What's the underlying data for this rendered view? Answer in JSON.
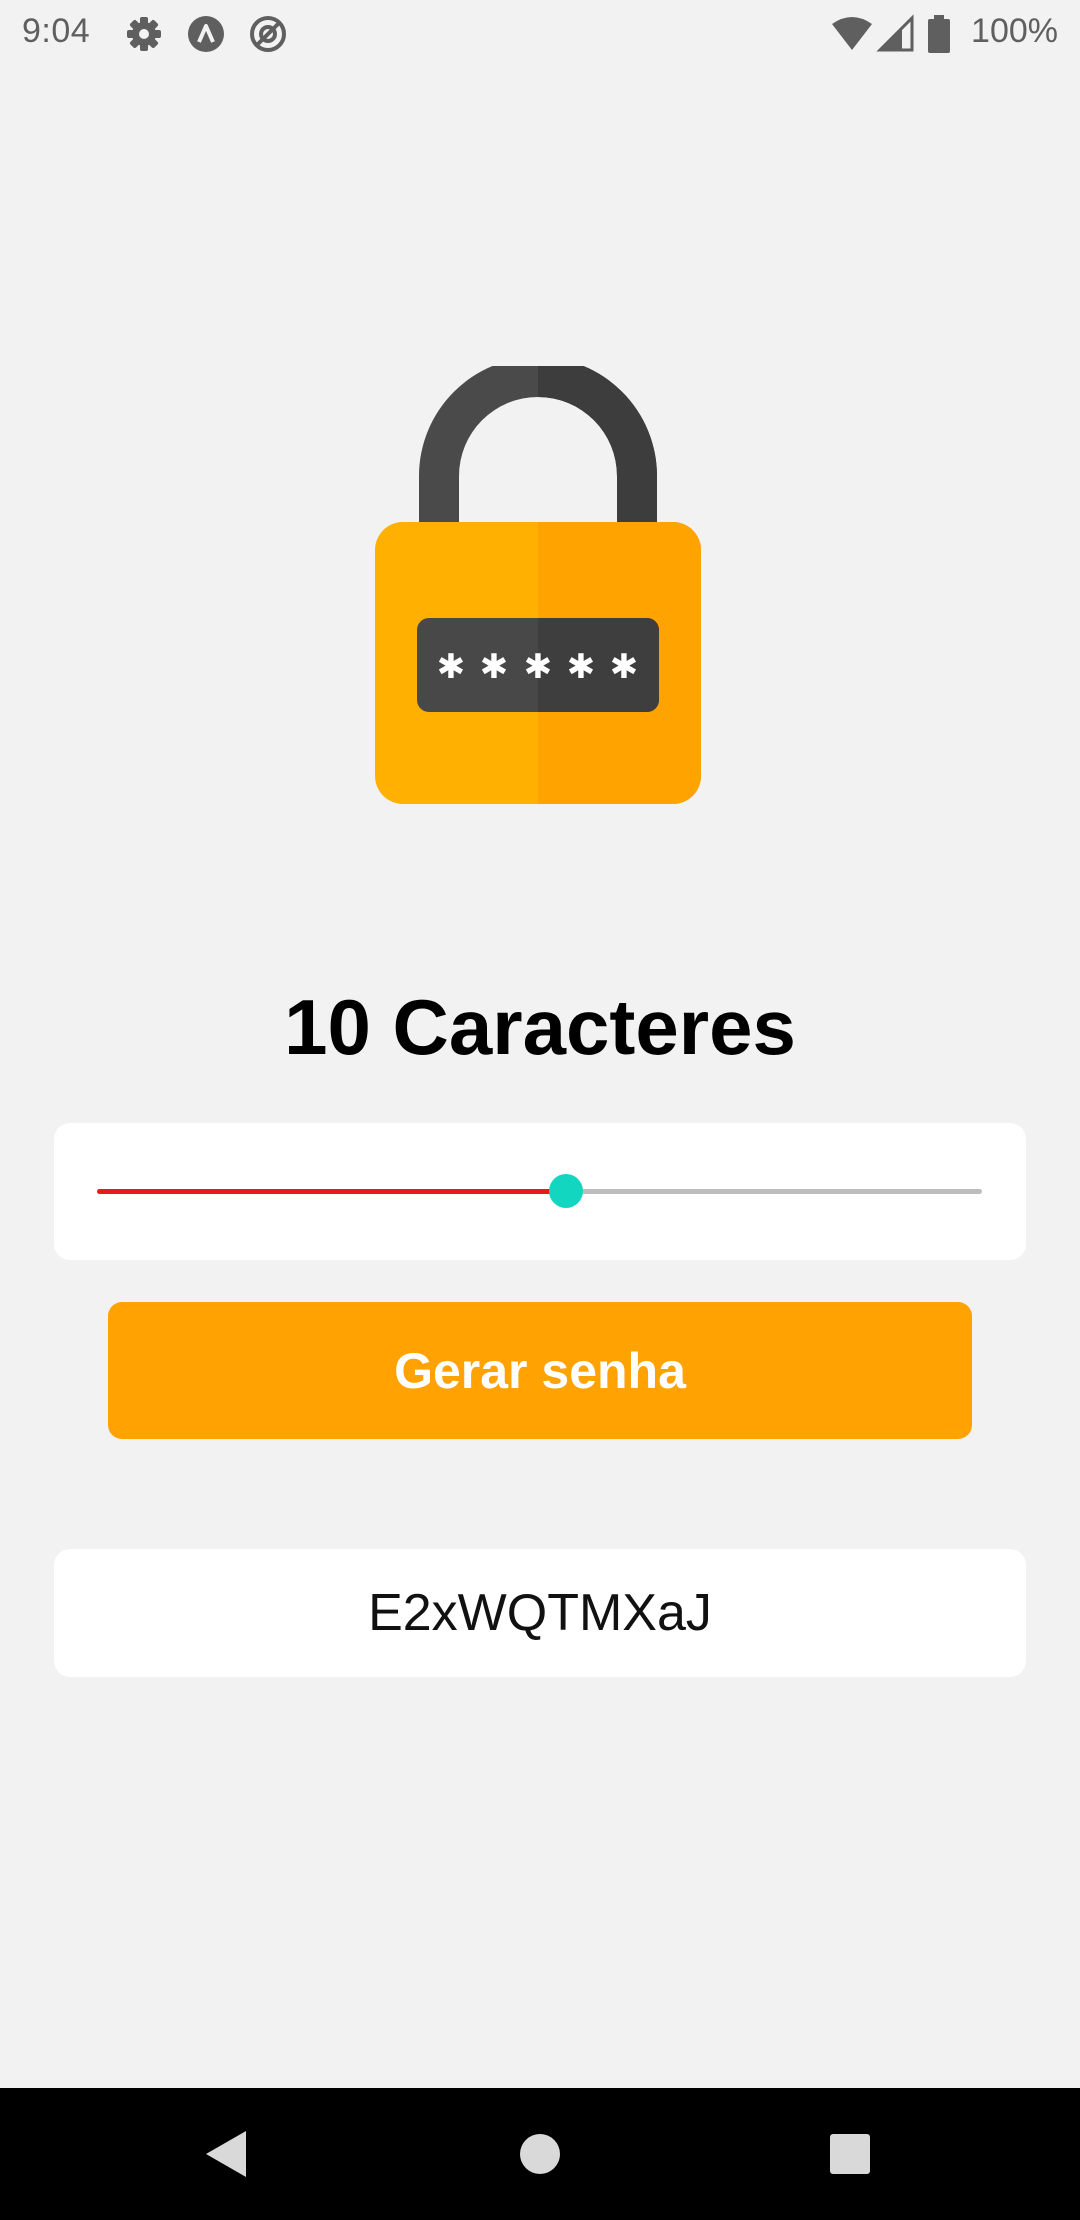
{
  "status_bar": {
    "time": "9:04",
    "icons": [
      "gear-icon",
      "react-icon",
      "at-sign-icon"
    ],
    "right_icons": [
      "wifi-icon",
      "signal-icon",
      "battery-icon"
    ],
    "battery": "100%"
  },
  "lock_image": {
    "icon": "padlock-password-icon"
  },
  "length_label": "10 Caracteres",
  "slider": {
    "value_fraction": 0.53,
    "min_color": "#e51c1c",
    "thumb_color": "#13d6c1"
  },
  "generate_button": {
    "label": "Gerar senha",
    "color": "#ffa202"
  },
  "password": "E2xWQTMXaJ",
  "nav": {
    "back": "back-icon",
    "home": "home-icon",
    "recents": "recents-icon"
  }
}
